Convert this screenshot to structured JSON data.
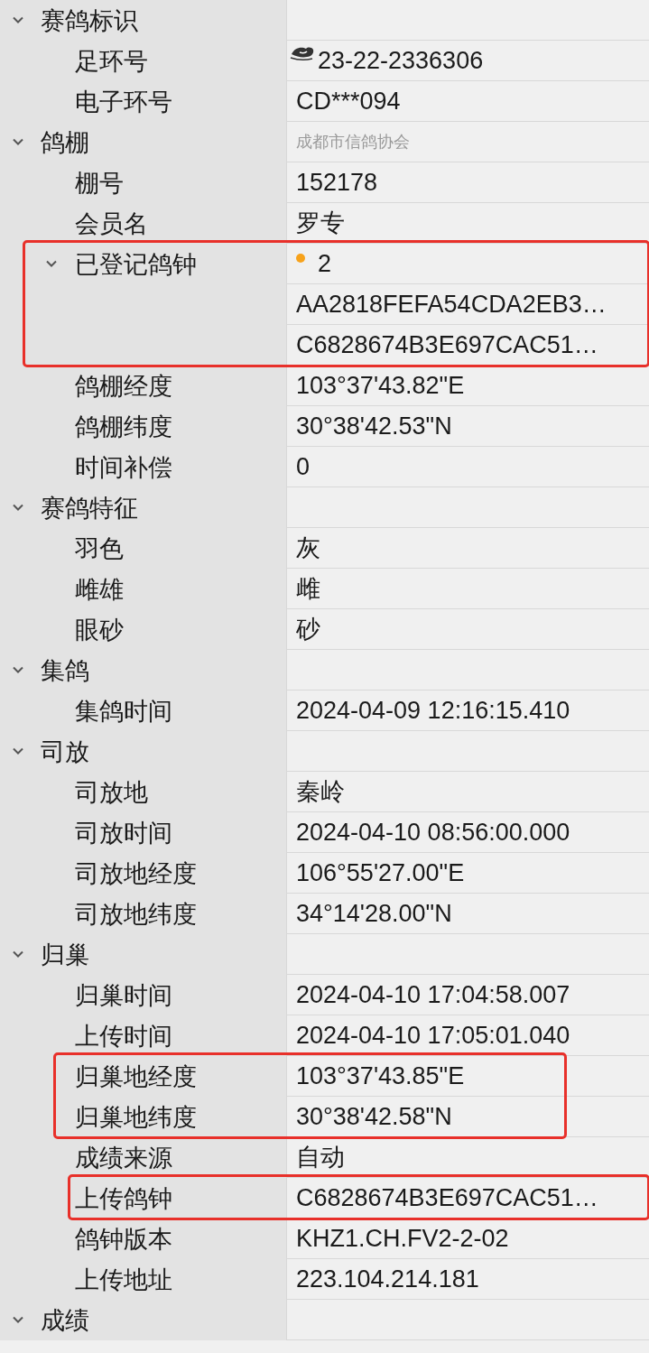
{
  "categories": [
    {
      "label": "赛鸽标识",
      "expanded": true,
      "children": [
        {
          "label": "足环号",
          "value": "23-22-2336306",
          "kind": "ring",
          "highlighted": false
        },
        {
          "label": "电子环号",
          "value": "CD***094",
          "highlighted": false
        }
      ]
    },
    {
      "label": "鸽棚",
      "expanded": true,
      "hint": "成都市信鸽协会",
      "children": [
        {
          "label": "棚号",
          "value": "152178",
          "highlighted": false
        },
        {
          "label": "会员名",
          "value": "罗专",
          "highlighted": false
        },
        {
          "label": "已登记鸽钟",
          "value": "2",
          "color": "#f7a21b",
          "expanded": true,
          "highlighted": true,
          "children": [
            {
              "value": "AA2818FEFA54CDA2EB3…",
              "highlighted": true
            },
            {
              "value": "C6828674B3E697CAC51…",
              "highlighted": true
            }
          ]
        },
        {
          "label": "鸽棚经度",
          "value": "103°37'43.82\"E",
          "highlighted": false
        },
        {
          "label": "鸽棚纬度",
          "value": "30°38'42.53\"N",
          "highlighted": false
        },
        {
          "label": "时间补偿",
          "value": "0",
          "highlighted": false
        }
      ]
    },
    {
      "label": "赛鸽特征",
      "expanded": true,
      "children": [
        {
          "label": "羽色",
          "value": "灰",
          "highlighted": false
        },
        {
          "label": "雌雄",
          "value": "雌",
          "highlighted": false
        },
        {
          "label": "眼砂",
          "value": "砂",
          "highlighted": false
        }
      ]
    },
    {
      "label": "集鸽",
      "expanded": true,
      "children": [
        {
          "label": "集鸽时间",
          "value": "2024-04-09 12:16:15.410",
          "highlighted": false
        }
      ]
    },
    {
      "label": "司放",
      "expanded": true,
      "children": [
        {
          "label": "司放地",
          "value": "秦岭",
          "highlighted": false
        },
        {
          "label": "司放时间",
          "value": "2024-04-10 08:56:00.000",
          "highlighted": false
        },
        {
          "label": "司放地经度",
          "value": "106°55'27.00\"E",
          "highlighted": false
        },
        {
          "label": "司放地纬度",
          "value": "34°14'28.00\"N",
          "highlighted": false
        }
      ]
    },
    {
      "label": "归巢",
      "expanded": true,
      "children": [
        {
          "label": "归巢时间",
          "value": "2024-04-10 17:04:58.007",
          "highlighted": false
        },
        {
          "label": "上传时间",
          "value": "2024-04-10 17:05:01.040",
          "highlighted": false
        },
        {
          "label": "归巢地经度",
          "value": "103°37'43.85\"E",
          "highlighted": true
        },
        {
          "label": "归巢地纬度",
          "value": "30°38'42.58\"N",
          "highlighted": true
        },
        {
          "label": "成绩来源",
          "value": "自动",
          "highlighted": false
        },
        {
          "label": "上传鸽钟",
          "value": "C6828674B3E697CAC51…",
          "highlighted": true
        },
        {
          "label": "鸽钟版本",
          "value": "KHZ1.CH.FV2-2-02",
          "highlighted": false
        },
        {
          "label": "上传地址",
          "value": "223.104.214.181",
          "highlighted": false
        }
      ]
    },
    {
      "label": "成绩",
      "expanded": true
    }
  ]
}
